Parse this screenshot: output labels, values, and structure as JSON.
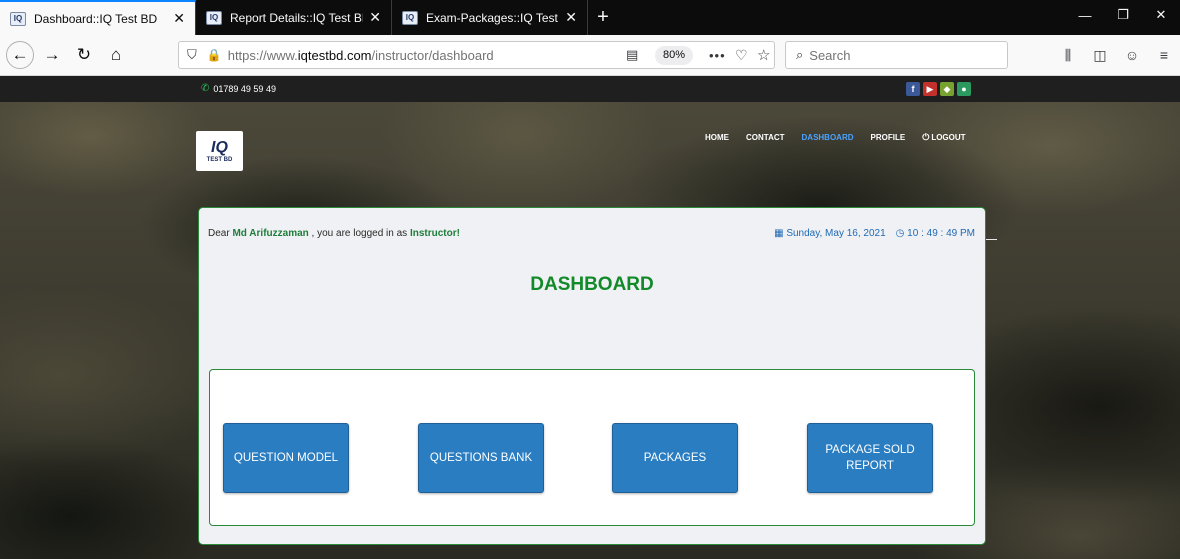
{
  "browser": {
    "tabs": [
      {
        "label": "Dashboard::IQ Test BD",
        "active": true
      },
      {
        "label": "Report Details::IQ Test BD",
        "active": false
      },
      {
        "label": "Exam-Packages::IQ Test BD",
        "active": false
      }
    ],
    "favicon_text": "IQ",
    "url_prefix": "https://www.",
    "url_domain": "iqtestbd.com",
    "url_path": "/instructor/dashboard",
    "zoom": "80%",
    "search_placeholder": "Search"
  },
  "site": {
    "phone": "01789 49 59 49",
    "socials": [
      "facebook-icon",
      "youtube-icon",
      "android-icon",
      "other-icon"
    ],
    "logo_mark": "IQ",
    "logo_sub": "TEST BD",
    "nav": [
      {
        "label": "HOME",
        "active": false
      },
      {
        "label": "CONTACT",
        "active": false
      },
      {
        "label": "DASHBOARD",
        "active": true
      },
      {
        "label": "PROFILE",
        "active": false
      },
      {
        "label": "LOGOUT",
        "active": false
      }
    ]
  },
  "dashboard": {
    "greeting_prefix": "Dear ",
    "user_name": "Md Arifuzzaman",
    "greeting_mid": " , you are logged in as ",
    "role": "Instructor!",
    "date": "Sunday, May 16, 2021",
    "time": "10 : 49 : 49 PM",
    "title": "DASHBOARD",
    "buttons": [
      "QUESTION MODEL",
      "QUESTIONS BANK",
      "PACKAGES",
      "PACKAGE SOLD REPORT"
    ]
  },
  "colors": {
    "accent_blue": "#2a7dc1",
    "title_green": "#128a2a",
    "nav_active": "#4aa3ff"
  }
}
